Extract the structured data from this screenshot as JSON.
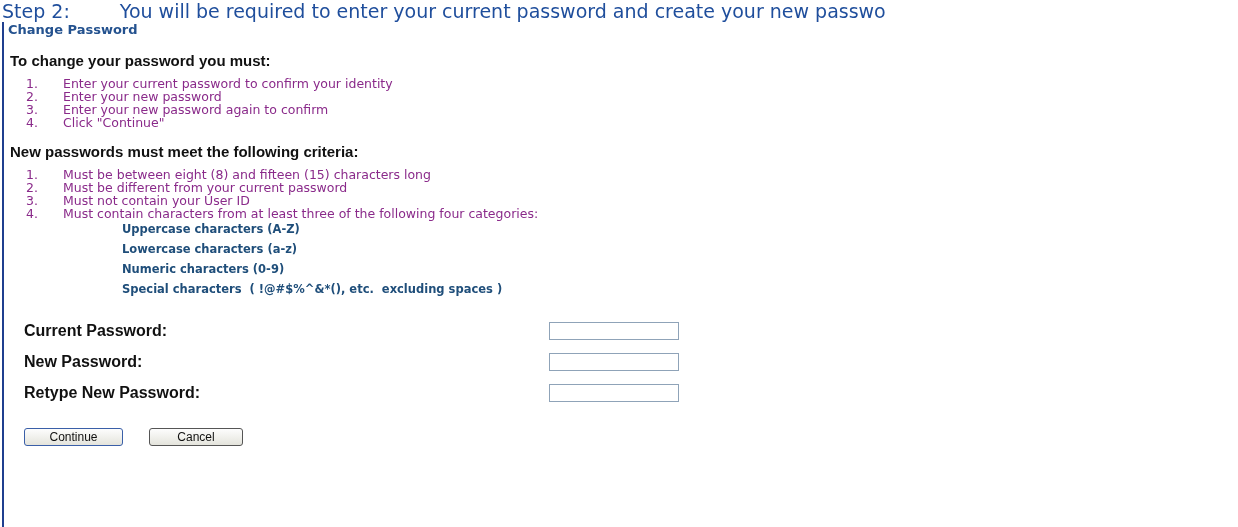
{
  "step_banner": {
    "step": "Step 2:",
    "text": "You will be required to enter your current password and create your new passwo"
  },
  "panel": {
    "title": "Change Password",
    "instructions_heading": "To change your password you must:",
    "instructions": [
      {
        "number": "1.",
        "text": "Enter your current password to confirm your identity"
      },
      {
        "number": "2.",
        "text": "Enter your new password"
      },
      {
        "number": "3.",
        "text": "Enter your new password again to confirm"
      },
      {
        "number": "4.",
        "text": "Click \"Continue\""
      }
    ],
    "criteria_heading": "New passwords must meet the following criteria:",
    "criteria": [
      {
        "number": "1.",
        "text": "Must be between eight (8) and fifteen (15) characters long"
      },
      {
        "number": "2.",
        "text": "Must be different from your current password"
      },
      {
        "number": "3.",
        "text": "Must not contain your User ID"
      },
      {
        "number": "4.",
        "text": "Must contain characters from at least three of the following four categories:"
      }
    ],
    "categories": [
      "Uppercase characters (A-Z)",
      "Lowercase characters (a-z)",
      "Numeric characters (0-9)",
      "Special characters  ( !@#$%^&*(), etc.  excluding spaces )"
    ],
    "fields": [
      {
        "label": "Current Password:"
      },
      {
        "label": "New Password:"
      },
      {
        "label": "Retype New Password:"
      }
    ],
    "buttons": [
      "Continue",
      "Cancel"
    ]
  }
}
